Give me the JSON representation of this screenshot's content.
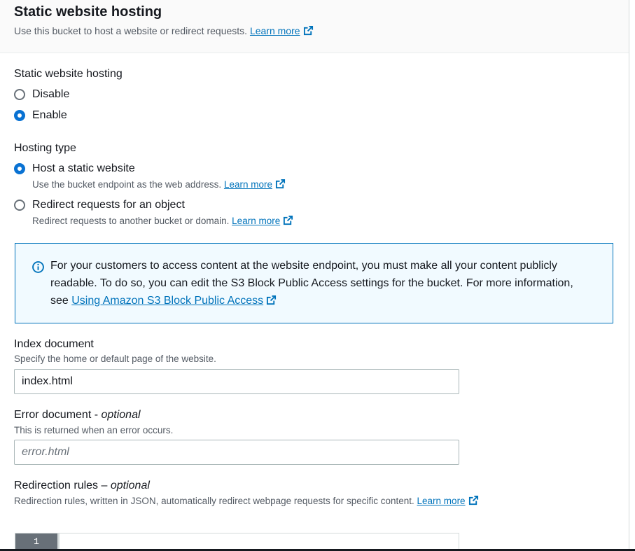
{
  "header": {
    "title": "Static website hosting",
    "description": "Use this bucket to host a website or redirect requests.",
    "learn_more": "Learn more"
  },
  "hosting": {
    "label": "Static website hosting",
    "options": [
      {
        "label": "Disable",
        "checked": false
      },
      {
        "label": "Enable",
        "checked": true
      }
    ]
  },
  "hosting_type": {
    "label": "Hosting type",
    "options": [
      {
        "label": "Host a static website",
        "description": "Use the bucket endpoint as the web address.",
        "learn_more": "Learn more",
        "checked": true
      },
      {
        "label": "Redirect requests for an object",
        "description": "Redirect requests to another bucket or domain.",
        "learn_more": "Learn more",
        "checked": false
      }
    ]
  },
  "alert": {
    "text": "For your customers to access content at the website endpoint, you must make all your content publicly readable. To do so, you can edit the S3 Block Public Access settings for the bucket. For more information, see",
    "link": "Using Amazon S3 Block Public Access"
  },
  "index_document": {
    "label": "Index document",
    "description": "Specify the home or default page of the website.",
    "value": "index.html"
  },
  "error_document": {
    "label": "Error document - ",
    "optional": "optional",
    "description": "This is returned when an error occurs.",
    "placeholder": "error.html"
  },
  "redirection_rules": {
    "label": "Redirection rules – ",
    "optional": "optional",
    "description": "Redirection rules, written in JSON, automatically redirect webpage requests for specific content.",
    "learn_more": "Learn more",
    "line_number": "1"
  },
  "colors": {
    "link": "#0073bb",
    "radio_checked": "#0972d3",
    "alert_bg": "#f1faff",
    "alert_border": "#0073bb"
  },
  "icons": [
    "external-link-icon",
    "info-icon"
  ]
}
